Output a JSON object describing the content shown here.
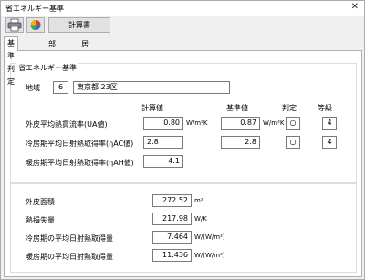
{
  "window": {
    "title": "省エネルギー基準",
    "close_symbol": "✕"
  },
  "toolbar": {
    "calc_label": "計算書"
  },
  "tabs": [
    {
      "label": "基準判定"
    },
    {
      "label": "部位別"
    },
    {
      "label": "居室床面積"
    }
  ],
  "group": {
    "title": "省エネルギー基準"
  },
  "region": {
    "label": "地域",
    "number": "6",
    "name": "東京都 23区"
  },
  "columns": {
    "calc": "計算値",
    "base": "基準値",
    "judge": "判定",
    "grade": "等級"
  },
  "rows": [
    {
      "label": "外皮平均熱貫流率(UA値)",
      "calc": "0.80",
      "unit": "W/m²K",
      "base": "0.87",
      "unit2": "W/m²K",
      "judge": "○",
      "grade": "4"
    },
    {
      "label": "冷房期平均日射熱取得率(ηAC値)",
      "calc": "2.8",
      "base": "2.8",
      "judge": "○",
      "grade": "4"
    },
    {
      "label": "暖房期平均日射熱取得率(ηAH値)",
      "calc": "4.1"
    }
  ],
  "summary": [
    {
      "label": "外皮面積",
      "value": "272.52",
      "unit": "m²"
    },
    {
      "label": "熱損失量",
      "value": "217.98",
      "unit": "W/K"
    },
    {
      "label": "冷房期の平均日射熱取得量",
      "value": "7.464",
      "unit": "W/(W/m²)"
    },
    {
      "label": "暖房期の平均日射熱取得量",
      "value": "11.436",
      "unit": "W/(W/m²)"
    }
  ],
  "icons": {
    "printer": "printer-icon",
    "color": "color-circle-icon"
  }
}
